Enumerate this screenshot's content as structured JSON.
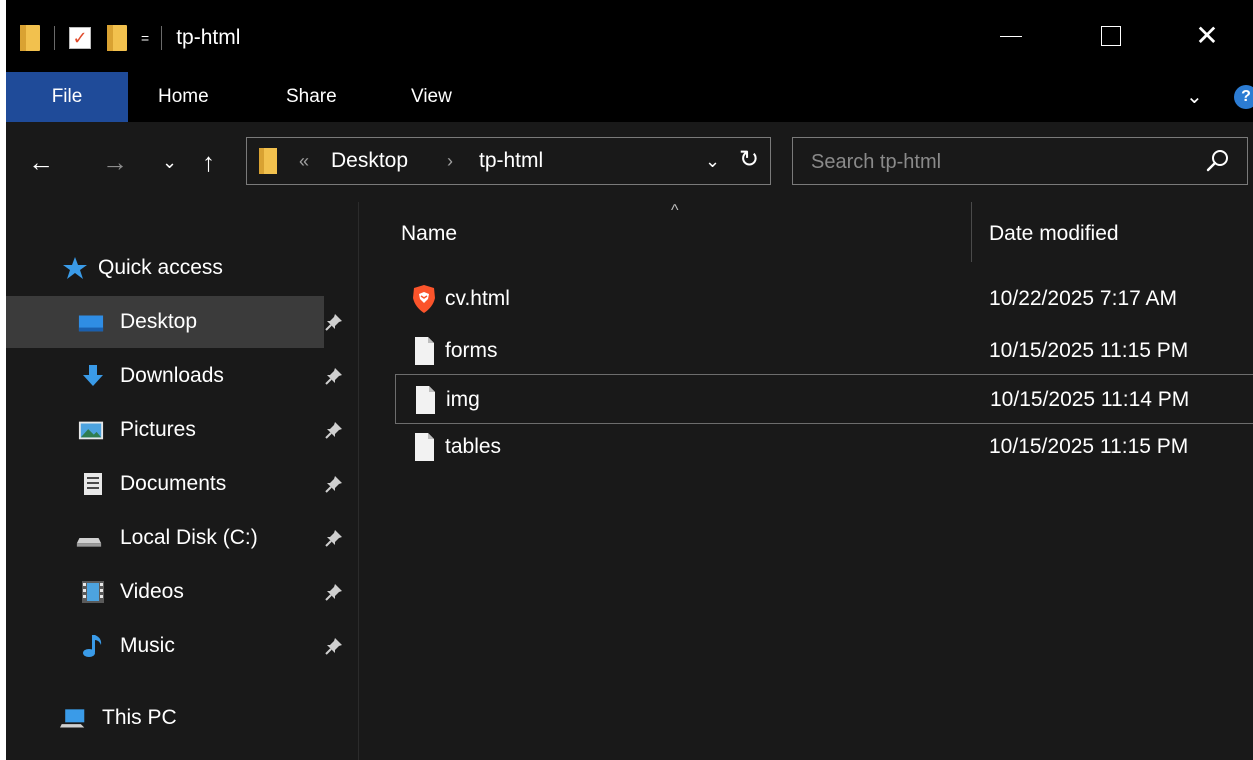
{
  "window": {
    "title": "tp-html",
    "min_glyph": "",
    "close_glyph": "✕",
    "qat_dropdown_glyph": "="
  },
  "ribbon": {
    "tabs": [
      "File",
      "Home",
      "Share",
      "View"
    ],
    "chevron_glyph": "⌄",
    "help_glyph": "?"
  },
  "address": {
    "back_glyph": "←",
    "forward_glyph": "→",
    "recent_glyph": "⌄",
    "up_glyph": "↑",
    "overflow_glyph": "«",
    "crumbs": [
      "Desktop",
      "tp-html"
    ],
    "separator_glyph": "›",
    "dropdown_glyph": "⌄",
    "refresh_glyph": "↻"
  },
  "search": {
    "placeholder": "Search tp-html",
    "value": ""
  },
  "navigation": {
    "quick_access": "Quick access",
    "items": [
      {
        "label": "Desktop",
        "icon": "desktop-icon",
        "pinned": true,
        "selected": true
      },
      {
        "label": "Downloads",
        "icon": "downloads-icon",
        "pinned": true
      },
      {
        "label": "Pictures",
        "icon": "pictures-icon",
        "pinned": true
      },
      {
        "label": "Documents",
        "icon": "documents-icon",
        "pinned": true
      },
      {
        "label": "Local Disk (C:)",
        "icon": "local-disk-icon",
        "pinned": true
      },
      {
        "label": "Videos",
        "icon": "videos-icon",
        "pinned": true
      },
      {
        "label": "Music",
        "icon": "music-icon",
        "pinned": true
      }
    ],
    "this_pc": "This PC"
  },
  "file_list": {
    "sort_glyph": "^",
    "columns": {
      "name": "Name",
      "date": "Date modified"
    },
    "rows": [
      {
        "name": "cv.html",
        "date": "10/22/2025 7:17 AM",
        "icon": "brave-html-icon"
      },
      {
        "name": "forms",
        "date": "10/15/2025 11:15 PM",
        "icon": "file-icon"
      },
      {
        "name": "img",
        "date": "10/15/2025 11:14 PM",
        "icon": "file-icon",
        "focused": true
      },
      {
        "name": "tables",
        "date": "10/15/2025 11:15 PM",
        "icon": "file-icon"
      }
    ]
  },
  "colors": {
    "window_bg": "#191919",
    "titlebar_bg": "#000000",
    "file_tab_bg": "#1f4b99",
    "selected_nav_bg": "#3b3b3b",
    "folder_yellow": "#f2c14e",
    "brave_orange": "#fb542b"
  }
}
